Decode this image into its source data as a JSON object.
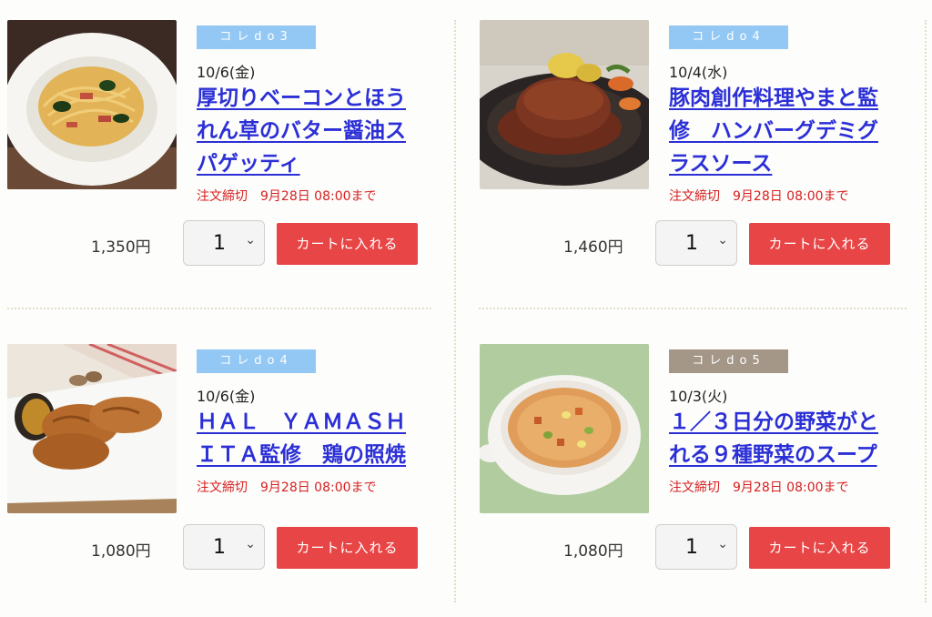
{
  "colors": {
    "badge_blue": "#93c8f4",
    "badge_brown": "#a59788",
    "link": "#2b2fd6",
    "deadline": "#d62020",
    "cart_button": "#e84646"
  },
  "products": [
    {
      "badge": "コレdo3",
      "badge_color": "#93c8f4",
      "date": "10/6(金)",
      "title": "厚切りベーコンとほうれん草のバター醤油スパゲッティ",
      "deadline": "注文締切　9月28日 08:00まで",
      "price": "1,350円",
      "qty": "1",
      "cart_label": "カートに入れる"
    },
    {
      "badge": "コレdo4",
      "badge_color": "#93c8f4",
      "date": "10/4(水)",
      "title": "豚肉創作料理やまと監修　ハンバーグデミグラスソース",
      "deadline": "注文締切　9月28日 08:00まで",
      "price": "1,460円",
      "qty": "1",
      "cart_label": "カートに入れる"
    },
    {
      "badge": "コレdo4",
      "badge_color": "#93c8f4",
      "date": "10/6(金)",
      "title": "ＨＡＬ　ＹＡＭＡＳＨＩＴＡ監修　鶏の照焼",
      "deadline": "注文締切　9月28日 08:00まで",
      "price": "1,080円",
      "qty": "1",
      "cart_label": "カートに入れる"
    },
    {
      "badge": "コレdo5",
      "badge_color": "#a59788",
      "date": "10/3(火)",
      "title": "１／３日分の野菜がとれる９種野菜のスープ",
      "deadline": "注文締切　9月28日 08:00まで",
      "price": "1,080円",
      "qty": "1",
      "cart_label": "カートに入れる"
    }
  ]
}
